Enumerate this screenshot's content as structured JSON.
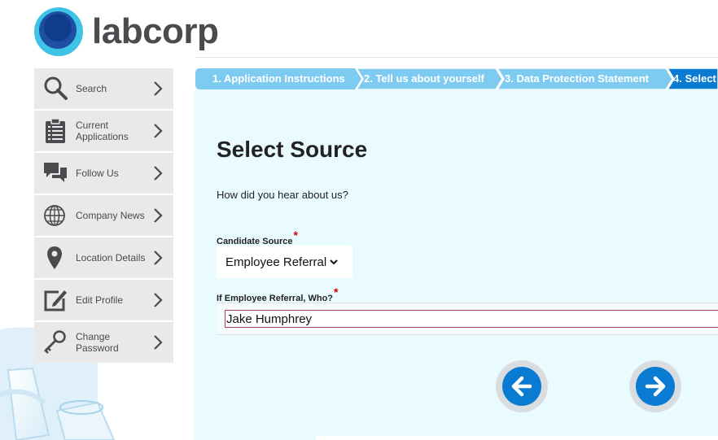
{
  "brand": {
    "name": "labcorp"
  },
  "sidebar": {
    "items": [
      {
        "label": "Search",
        "icon": "search-icon"
      },
      {
        "label": "Current Applications",
        "icon": "clipboard-icon"
      },
      {
        "label": "Follow Us",
        "icon": "chat-bubbles-icon"
      },
      {
        "label": "Company News",
        "icon": "globe-icon"
      },
      {
        "label": "Location Details",
        "icon": "map-pin-icon"
      },
      {
        "label": "Edit Profile",
        "icon": "edit-icon"
      },
      {
        "label": "Change Password",
        "icon": "key-icon"
      }
    ]
  },
  "steps": [
    {
      "label": "1. Application Instructions",
      "state": "done"
    },
    {
      "label": "2. Tell us about yourself",
      "state": "done"
    },
    {
      "label": "3. Data Protection Statement",
      "state": "done"
    },
    {
      "label": "4. Select",
      "state": "current"
    }
  ],
  "form": {
    "title": "Select Source",
    "question": "How did you hear about us?",
    "candidate_source": {
      "label": "Candidate Source",
      "required_mark": "*",
      "value": "Employee Referral"
    },
    "referral": {
      "label": "If Employee Referral, Who?",
      "required_mark": "*",
      "value": "Jake Humphrey"
    }
  },
  "navigation": {
    "back_icon": "arrow-left-icon",
    "next_icon": "arrow-right-icon"
  },
  "colors": {
    "step_done": "#7ecbf2",
    "step_current": "#0a7bd3",
    "panel_bg": "#e9fbff",
    "sidebar_bg": "#e9e9e9",
    "nav_button": "#0a7bd3",
    "required": "#d40000"
  }
}
